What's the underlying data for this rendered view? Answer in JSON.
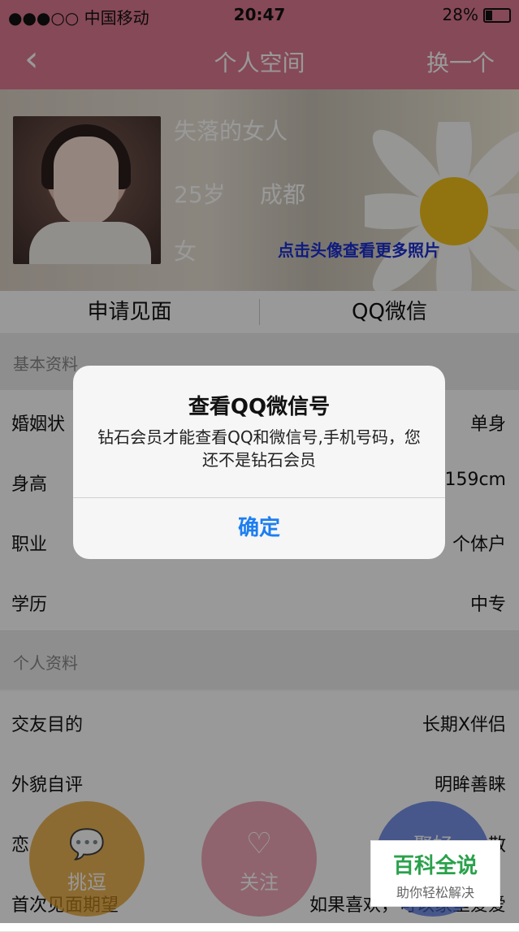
{
  "status_bar": {
    "carrier": "●●●○○ 中国移动",
    "time": "20:47",
    "battery": "28%"
  },
  "nav": {
    "back_icon": "‹",
    "title": "个人空间",
    "switch_label": "换一个"
  },
  "profile": {
    "name": "失落的女人",
    "age": "25岁",
    "city": "成都",
    "gender": "女",
    "more_photos": "点击头像查看更多照片"
  },
  "actions": {
    "meet": "申请见面",
    "qq_wechat": "QQ微信"
  },
  "sections": {
    "basic": "基本资料",
    "personal": "个人资料"
  },
  "basic_rows": [
    {
      "k": "婚姻状",
      "v": "单身"
    },
    {
      "k": "身高",
      "v": "159cm"
    },
    {
      "k": "职业",
      "v": "个体户"
    },
    {
      "k": "学历",
      "v": "中专"
    }
  ],
  "personal_rows": [
    {
      "k": "交友目的",
      "v": "长期X伴侣"
    },
    {
      "k": "外貌自评",
      "v": "明眸善睐"
    },
    {
      "k": "恋",
      "v": "散"
    },
    {
      "k": "首次见面期望",
      "v": "如果喜欢，可以家里爱爱"
    }
  ],
  "dialog": {
    "title": "查看QQ微信号",
    "message": "钻石会员才能查看QQ和微信号,手机号码，您还不是钻石会员",
    "ok": "确定"
  },
  "fabs": {
    "tease": "挑逗",
    "follow": "关注",
    "hello": "聚好"
  },
  "watermark": {
    "brand": "百科全说",
    "slogan": "助你轻松解决"
  },
  "colors": {
    "header": "#e07a92",
    "link_blue": "#1c7ef1"
  }
}
